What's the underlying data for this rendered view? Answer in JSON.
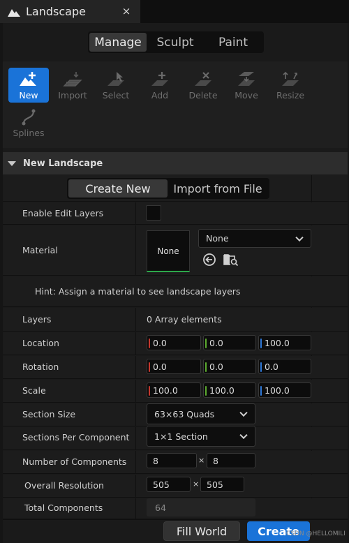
{
  "tab": {
    "title": "Landscape",
    "close": "×"
  },
  "modes": [
    "Manage",
    "Sculpt",
    "Paint"
  ],
  "tools": [
    {
      "label": "New",
      "icon": "new-landscape-icon"
    },
    {
      "label": "Import",
      "icon": "import-icon"
    },
    {
      "label": "Select",
      "icon": "select-icon"
    },
    {
      "label": "Add",
      "icon": "add-icon"
    },
    {
      "label": "Delete",
      "icon": "delete-icon"
    },
    {
      "label": "Move",
      "icon": "move-icon"
    },
    {
      "label": "Resize",
      "icon": "resize-icon"
    },
    {
      "label": "Splines",
      "icon": "splines-icon"
    }
  ],
  "section": {
    "title": "New Landscape"
  },
  "import_toggle": [
    "Create New",
    "Import from File"
  ],
  "properties": {
    "enable_edit_layers": {
      "label": "Enable Edit Layers"
    },
    "material": {
      "label": "Material",
      "thumb": "None",
      "value": "None"
    },
    "hint": "Hint: Assign a material to see landscape layers",
    "layers": {
      "label": "Layers",
      "value": "0 Array elements"
    },
    "location": {
      "label": "Location",
      "x": "0.0",
      "y": "0.0",
      "z": "100.0"
    },
    "rotation": {
      "label": "Rotation",
      "x": "0.0",
      "y": "0.0",
      "z": "0.0"
    },
    "scale": {
      "label": "Scale",
      "x": "100.0",
      "y": "100.0",
      "z": "100.0"
    },
    "section_size": {
      "label": "Section Size",
      "value": "63×63 Quads"
    },
    "sections_per_component": {
      "label": "Sections Per Component",
      "value": "1×1 Section"
    },
    "number_of_components": {
      "label": "Number of Components",
      "x": "8",
      "sep": "×",
      "y": "8"
    },
    "overall_resolution": {
      "label": "Overall Resolution",
      "x": "505",
      "sep": "×",
      "y": "505"
    },
    "total_components": {
      "label": "Total Components",
      "value": "64"
    }
  },
  "buttons": {
    "fill_world": "Fill World",
    "create": "Create"
  },
  "watermark": "CSDN @HELLOMILI",
  "colors": {
    "accent": "#1a73d8",
    "axis_x": "#c4372d",
    "axis_y": "#5cab2f",
    "axis_z": "#2e78d6",
    "material_ok": "#2ca84a"
  }
}
